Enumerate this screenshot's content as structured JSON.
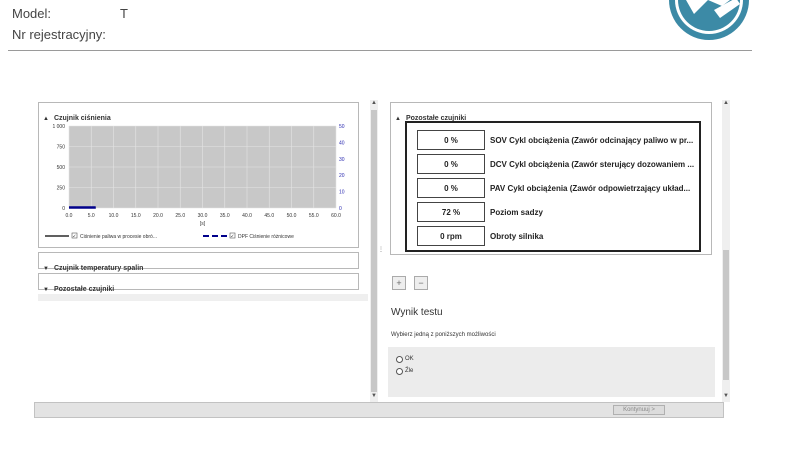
{
  "header": {
    "model_label": "Model:",
    "model_value": "T",
    "registration_label": "Nr rejestracyjny:"
  },
  "left_panel": {
    "pressure_section_title": "Czujnik ciśnienia",
    "temperature_section_title": "Czujnik temperatury spalin",
    "other_sensors_title": "Pozostałe czujniki"
  },
  "chart_data": {
    "type": "line",
    "title": "",
    "xlabel": "[s]",
    "ylabel": "",
    "x_ticks": [
      "0.0",
      "5.0",
      "10.0",
      "15.0",
      "20.0",
      "25.0",
      "30.0",
      "35.0",
      "40.0",
      "45.0",
      "50.0",
      "55.0",
      "60.0"
    ],
    "y_ticks_left": [
      "0",
      "250",
      "500",
      "750",
      "1 000"
    ],
    "y_ticks_right": [
      "0",
      "10",
      "20",
      "30",
      "40",
      "50"
    ],
    "xlim": [
      0,
      60
    ],
    "ylim_left": [
      0,
      1000
    ],
    "ylim_right": [
      0,
      50
    ],
    "grid": true,
    "legend_position": "bottom",
    "series": [
      {
        "name": "Ciśnienie paliwa w procesie obró...",
        "color": "#000000",
        "axis": "left",
        "x": [
          0,
          6
        ],
        "values": [
          0,
          0
        ]
      },
      {
        "name": "DPF Ciśnienie różnicowe",
        "color": "#00008b",
        "axis": "right",
        "x": [
          0,
          6
        ],
        "values": [
          0.3,
          0.3
        ]
      }
    ]
  },
  "right_panel": {
    "section_title": "Pozostałe czujniki",
    "rows": [
      {
        "value": "0 %",
        "label": "SOV Cykl obciążenia (Zawór odcinający paliwo w pr..."
      },
      {
        "value": "0 %",
        "label": "DCV Cykl obciążenia (Zawór sterujący dozowaniem ..."
      },
      {
        "value": "0 %",
        "label": "PAV Cykl obciążenia (Zawór odpowietrzający układ..."
      },
      {
        "value": "72 %",
        "label": "Poziom sadzy"
      },
      {
        "value": "0 rpm",
        "label": "Obroty silnika"
      }
    ],
    "zoom_in_symbol": "+",
    "zoom_out_symbol": "−",
    "result_title": "Wynik testu",
    "instruction": "Wybierz jedną z poniższych możliwości",
    "options": [
      "OK",
      "Źle"
    ]
  },
  "footer": {
    "continue_label": "Kontynuuj >"
  },
  "colors": {
    "plot_bg": "#c8c8c8",
    "series_dark": "#00008b",
    "right_axis_text": "#2a2ab0"
  }
}
